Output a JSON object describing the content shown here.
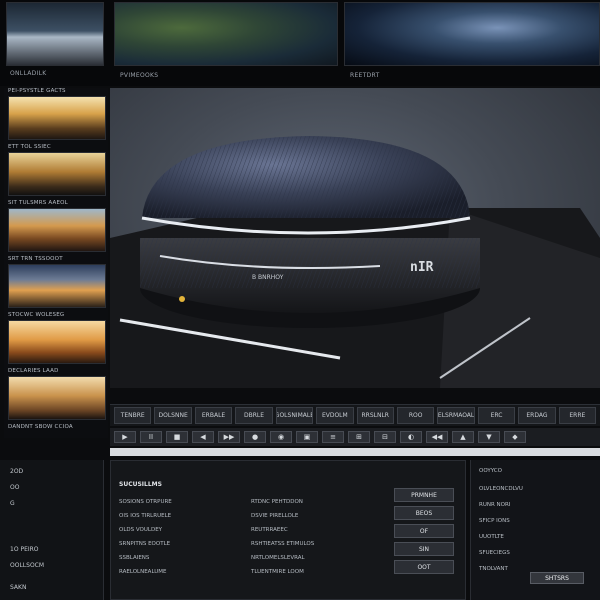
{
  "top_strip": {
    "thumbnails": [
      {
        "caption": "ONLLADILK"
      },
      {
        "caption": "PVIMEOOKS"
      },
      {
        "caption": "REETDRT"
      }
    ]
  },
  "thumb_column": {
    "thumbnails": [
      {
        "label": "PEI-PSYSTLE GACTS"
      },
      {
        "label": "ETT TOL SSIEC"
      },
      {
        "label": "SIT TULSMRS AAEOL"
      },
      {
        "label": "SRT TRN TSSOOOT"
      },
      {
        "label": "STOCWC WOLESEG"
      },
      {
        "label": "DECLARIES LAAD"
      },
      {
        "label": "DANDNT SBOW CCIOA"
      }
    ]
  },
  "viewport": {
    "object_badge": "nIR",
    "object_caption": "B  BNRHOY",
    "colors": {
      "dome": "#3a4258",
      "base": "#1c1d21",
      "rim": "#e8ecf2"
    }
  },
  "tabs": [
    "TENBRE",
    "DOLSNNE",
    "ERBALE",
    "DBRLE",
    "GOLSNIMALE",
    "EVDOLM",
    "RRSLNLR",
    "ROO",
    "ELSRMAOAL",
    "ERC",
    "ERDAG",
    "ERRE"
  ],
  "controls": [
    "▶",
    "II",
    "■",
    "◀",
    "▶▶",
    "●",
    "◉",
    "▣",
    "≡",
    "⊞",
    "⊟",
    "◐",
    "◀◀",
    "▲",
    "▼",
    "◆"
  ],
  "bottom_left": {
    "rows": [
      "2OD",
      "OO",
      "G",
      "1O PEIRO",
      "OOLLSOCM",
      "SAKN"
    ]
  },
  "bottom_middle": {
    "title": "SUCUSILLMS",
    "left_props": [
      "SOSIONS OTRPURE",
      "OIS IOS TIRLRUELE",
      "OLDS VOULDEY",
      "SRNPITNS EOOTLE",
      "SSBLAIENS",
      "RAELOLNEALUME"
    ],
    "right_props": [
      "RTDNC PEHTDDON",
      "DSVIE PIRELLOLE",
      "REUTRRAEEC",
      "RSHTIEATSS ETIMULOS",
      "NRTLOMELSLEVRAL",
      "TLUENTMIRE LOOM"
    ],
    "side_buttons": [
      "PRMNHE",
      "BEOS",
      "OF",
      "SIN",
      "OOT"
    ]
  },
  "bottom_right": {
    "rows": [
      "OOYYCO",
      "OLVLEONCDLVU",
      "RUNR NORI",
      "SFICP IONS",
      "UUOTLTE",
      "SFUECIEGS",
      "TNOLVANT"
    ],
    "export_label": "SHTSRS"
  }
}
